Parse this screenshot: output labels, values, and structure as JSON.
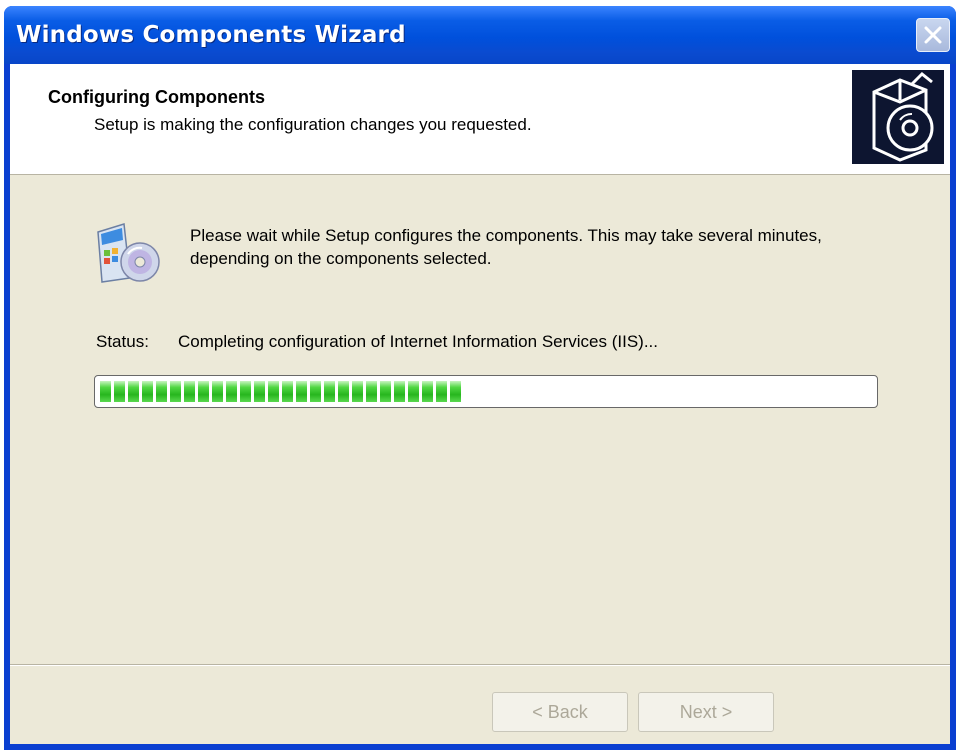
{
  "window": {
    "title": "Windows Components Wizard",
    "close_icon": "close-icon"
  },
  "header": {
    "title": "Configuring Components",
    "subtitle": "Setup is making the configuration changes you requested.",
    "icon": "software-box-cd-icon"
  },
  "body": {
    "icon": "setup-components-icon",
    "message": "Please wait while Setup configures the components. This may take several minutes, depending on the components selected.",
    "status_label": "Status:",
    "status_value": "Completing configuration of Internet Information Services (IIS)...",
    "progress_fraction": 0.48
  },
  "buttons": {
    "back_label": "< Back",
    "next_label": "Next >"
  },
  "colors": {
    "titlebar": "#0050dc",
    "dialog_bg": "#ece9d8",
    "progress_green": "#27b61e"
  }
}
